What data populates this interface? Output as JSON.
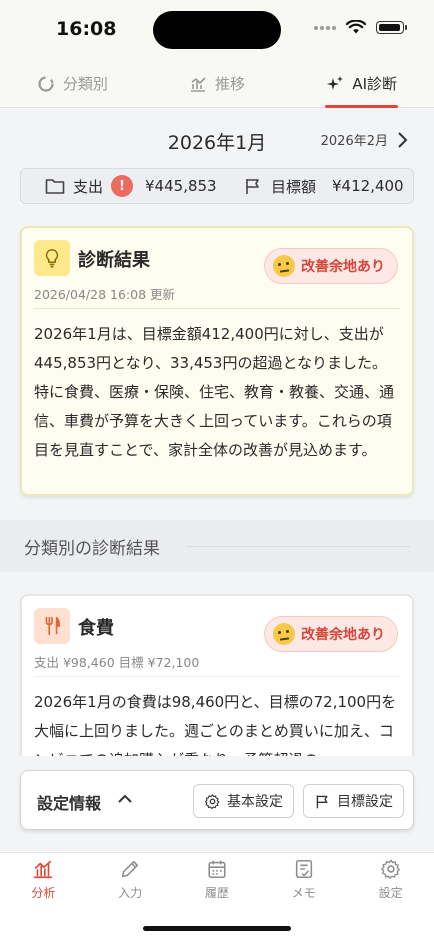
{
  "status": {
    "time": "16:08"
  },
  "tabs": [
    {
      "label": "分類別",
      "active": false
    },
    {
      "label": "推移",
      "active": false
    },
    {
      "label": "AI診断",
      "active": true
    }
  ],
  "month": {
    "current": "2026年1月",
    "next": "2026年2月"
  },
  "budget": {
    "expense_label": "支出",
    "expense_value": "¥445,853",
    "alert": "!",
    "target_label": "目標額",
    "target_value": "¥412,400"
  },
  "diagnosis": {
    "title": "診断結果",
    "updated": "2026/04/28 16:08 更新",
    "badge": "改善余地あり",
    "body": "2026年1月は、目標金額412,400円に対し、支出が445,853円となり、33,453円の超過となりました。特に食費、医療・保険、住宅、教育・教養、交通、通信、車費が予算を大きく上回っています。これらの項目を見直すことで、家計全体の改善が見込めます。"
  },
  "section": {
    "title": "分類別の診断結果"
  },
  "category": {
    "title": "食費",
    "sub": "支出 ¥98,460 目標 ¥72,100",
    "badge": "改善余地あり",
    "body": "2026年1月の食費は98,460円と、目標の72,100円を大幅に上回りました。週ごとのまとめ買いに加え、コンビニでの追加購入が重なり、予算超過の"
  },
  "settings": {
    "label": "設定情報",
    "basic_button": "基本設定",
    "target_button": "目標設定"
  },
  "nav": [
    {
      "label": "分析",
      "icon": "chart-icon",
      "active": true
    },
    {
      "label": "入力",
      "icon": "pencil-icon",
      "active": false
    },
    {
      "label": "履歴",
      "icon": "calendar-icon",
      "active": false
    },
    {
      "label": "メモ",
      "icon": "memo-icon",
      "active": false
    },
    {
      "label": "設定",
      "icon": "gear-icon",
      "active": false
    }
  ],
  "colors": {
    "accent": "#e0473c",
    "badge_bg": "#fde8e5",
    "diag_card_bg": "#fffdf0"
  }
}
